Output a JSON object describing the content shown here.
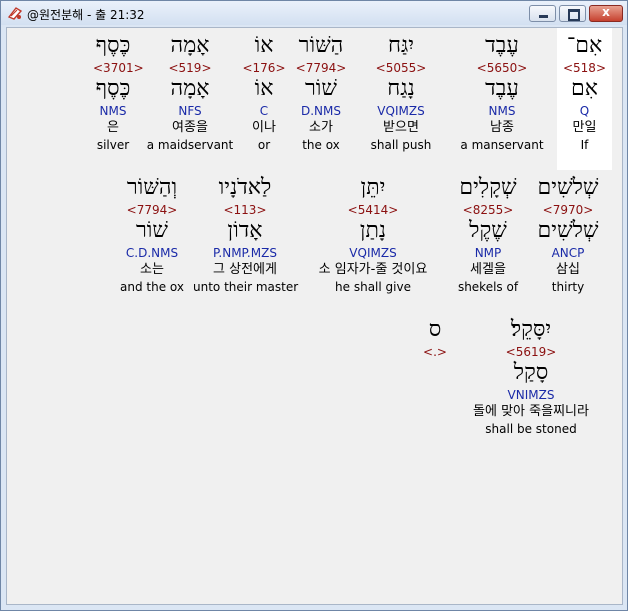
{
  "window": {
    "title": "@원전분해 - 출 21:32",
    "close_glyph": "x"
  },
  "rows": [
    [
      {
        "heb": "כֶּסֶף",
        "strong": "<3701>",
        "heb2": "כֶּסֶף",
        "morph": "NMS",
        "kor": "은",
        "eng": "silver"
      },
      {
        "heb": "אָמָה",
        "strong": "<519>",
        "heb2": "אָמָה",
        "morph": "NFS",
        "kor": "여종을",
        "eng": "a maidservant"
      },
      {
        "heb": "אוֹ",
        "strong": "<176>",
        "heb2": "אוֹ",
        "morph": "C",
        "kor": "이나",
        "eng": "or"
      },
      {
        "heb": "הַשּׁוֹר",
        "strong": "<7794>",
        "heb2": "שׁוֹר",
        "morph": "D.NMS",
        "kor": "소가",
        "eng": "the ox"
      },
      {
        "heb": "יִגַּח",
        "strong": "<5055>",
        "heb2": "נָגַח",
        "morph": "VQIMZS",
        "kor": "받으면",
        "eng": "shall push"
      },
      {
        "heb": "עֶבֶד",
        "strong": "<5650>",
        "heb2": "עֶבֶד",
        "morph": "NMS",
        "kor": "남종",
        "eng": "a manservant"
      },
      {
        "heb": "אִם־",
        "strong": "<518>",
        "heb2": "אִם",
        "morph": "Q",
        "kor": "만일",
        "eng": "If",
        "selected": true
      }
    ],
    [
      {
        "heb": "וְהַשּׁוֹר",
        "strong": "<7794>",
        "heb2": "שׁוֹר",
        "morph": "C.D.NMS",
        "kor": "소는",
        "eng": "and the ox"
      },
      {
        "heb": "לַאדֹנָיו",
        "strong": "<113>",
        "heb2": "אָדוֹן",
        "morph": "P.NMP.MZS",
        "kor": "그 상전에게",
        "eng": "unto their master"
      },
      {
        "heb": "יִתֵּן",
        "strong": "<5414>",
        "heb2": "נָתַן",
        "morph": "VQIMZS",
        "kor": "소 임자가-줄 것이요",
        "eng": "he shall give"
      },
      {
        "heb": "שְׁקָלִים",
        "strong": "<8255>",
        "heb2": "שֶׁקֶל",
        "morph": "NMP",
        "kor": "세겔을",
        "eng": "shekels of"
      },
      {
        "heb": "שְׁלֹשִׁים",
        "strong": "<7970>",
        "heb2": "שְׁלֹשִׁים",
        "morph": "ANCP",
        "kor": "삼십",
        "eng": "thirty"
      }
    ],
    [
      {
        "heb": "ס",
        "strong": "<.>"
      },
      {
        "heb": "יִסָּקֵל׃",
        "strong": "<5619>",
        "heb2": "סָקַל",
        "morph": "VNIMZS",
        "kor": "돌에 맞아 죽을찌니라",
        "eng": "shall be stoned"
      }
    ]
  ]
}
